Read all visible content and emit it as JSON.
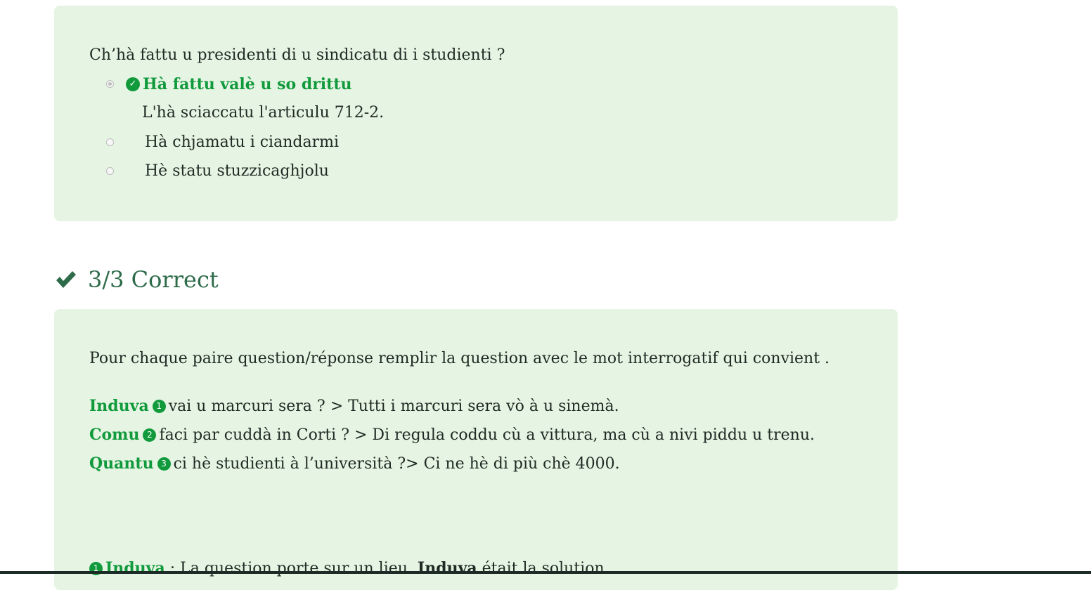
{
  "question1": {
    "prompt": "Ch’hà fattu u presidenti di u sindicatu di i studienti ?",
    "choices": [
      {
        "label": "Hà fattu valè u so drittu",
        "selected": true,
        "correct": true
      },
      {
        "label": "Hà chjamatu i ciandarmi",
        "selected": false,
        "correct": false
      },
      {
        "label": "Hè statu stuzzicaghjolu",
        "selected": false,
        "correct": false
      }
    ],
    "feedback": "L'hà sciaccatu l'articulu 712-2."
  },
  "score": {
    "icon": "checkmark-icon",
    "text": "3/3 Correct"
  },
  "question2": {
    "instruction": "Pour chaque paire question/réponse remplir la question avec le mot interrogatif qui convient .",
    "items": [
      {
        "answer": "Induva",
        "number": "1",
        "rest": "vai u marcuri sera ? > Tutti i marcuri sera vò à u sinemà."
      },
      {
        "answer": "Comu",
        "number": "2",
        "rest": "faci par cuddà in Corti ? > Di regula coddu cù a vittura, ma cù a nivi piddu u trenu."
      },
      {
        "answer": "Quantu",
        "number": "3",
        "rest": "ci hè studienti à l’università ?> Ci ne hè di più chè 4000."
      }
    ],
    "explanation": {
      "number": "1",
      "word": "Induva",
      "text1": " : La question porte sur un lieu. ",
      "word2": "Induva",
      "text2": " était la solution."
    }
  },
  "colors": {
    "card_bg": "#e6f4e3",
    "correct_green": "#109a3c",
    "score_green": "#2e6b4a"
  }
}
